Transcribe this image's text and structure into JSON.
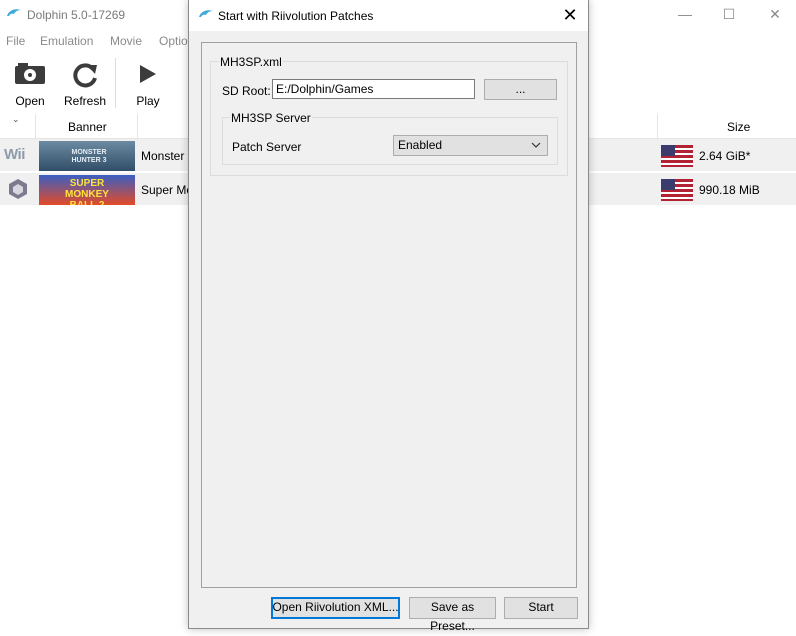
{
  "main_window": {
    "title": "Dolphin 5.0-17269",
    "controls": {
      "minimize": "—",
      "maximize": "☐",
      "close": "✕"
    },
    "menu": [
      "File",
      "Emulation",
      "Movie",
      "Optio"
    ],
    "toolbar": {
      "open": "Open",
      "refresh": "Refresh",
      "play": "Play"
    },
    "columns": {
      "banner": "Banner",
      "size": "Size"
    },
    "games": [
      {
        "platform": "Wii",
        "banner_text": "MONSTER HUNTER 3",
        "title": "Monster",
        "size": "2.64 GiB*"
      },
      {
        "platform": "GameCube",
        "banner_text": "SUPER MONKEY BALL 2",
        "title": "Super Mo",
        "size": "990.18 MiB"
      }
    ]
  },
  "dialog": {
    "title": "Start with Riivolution Patches",
    "close": "✕",
    "xml_group": "MH3SP.xml",
    "sd_root_label": "SD Root:",
    "sd_root_value": "E:/Dolphin/Games",
    "browse_label": "...",
    "server_group": "MH3SP Server",
    "patch_server_label": "Patch Server",
    "patch_server_value": "Enabled",
    "buttons": {
      "open_xml": "Open Riivolution XML...",
      "save_preset": "Save as Preset...",
      "start": "Start"
    }
  },
  "colors": {
    "accent": "#0078d7",
    "dolphin_blue": "#3fa9d9"
  }
}
